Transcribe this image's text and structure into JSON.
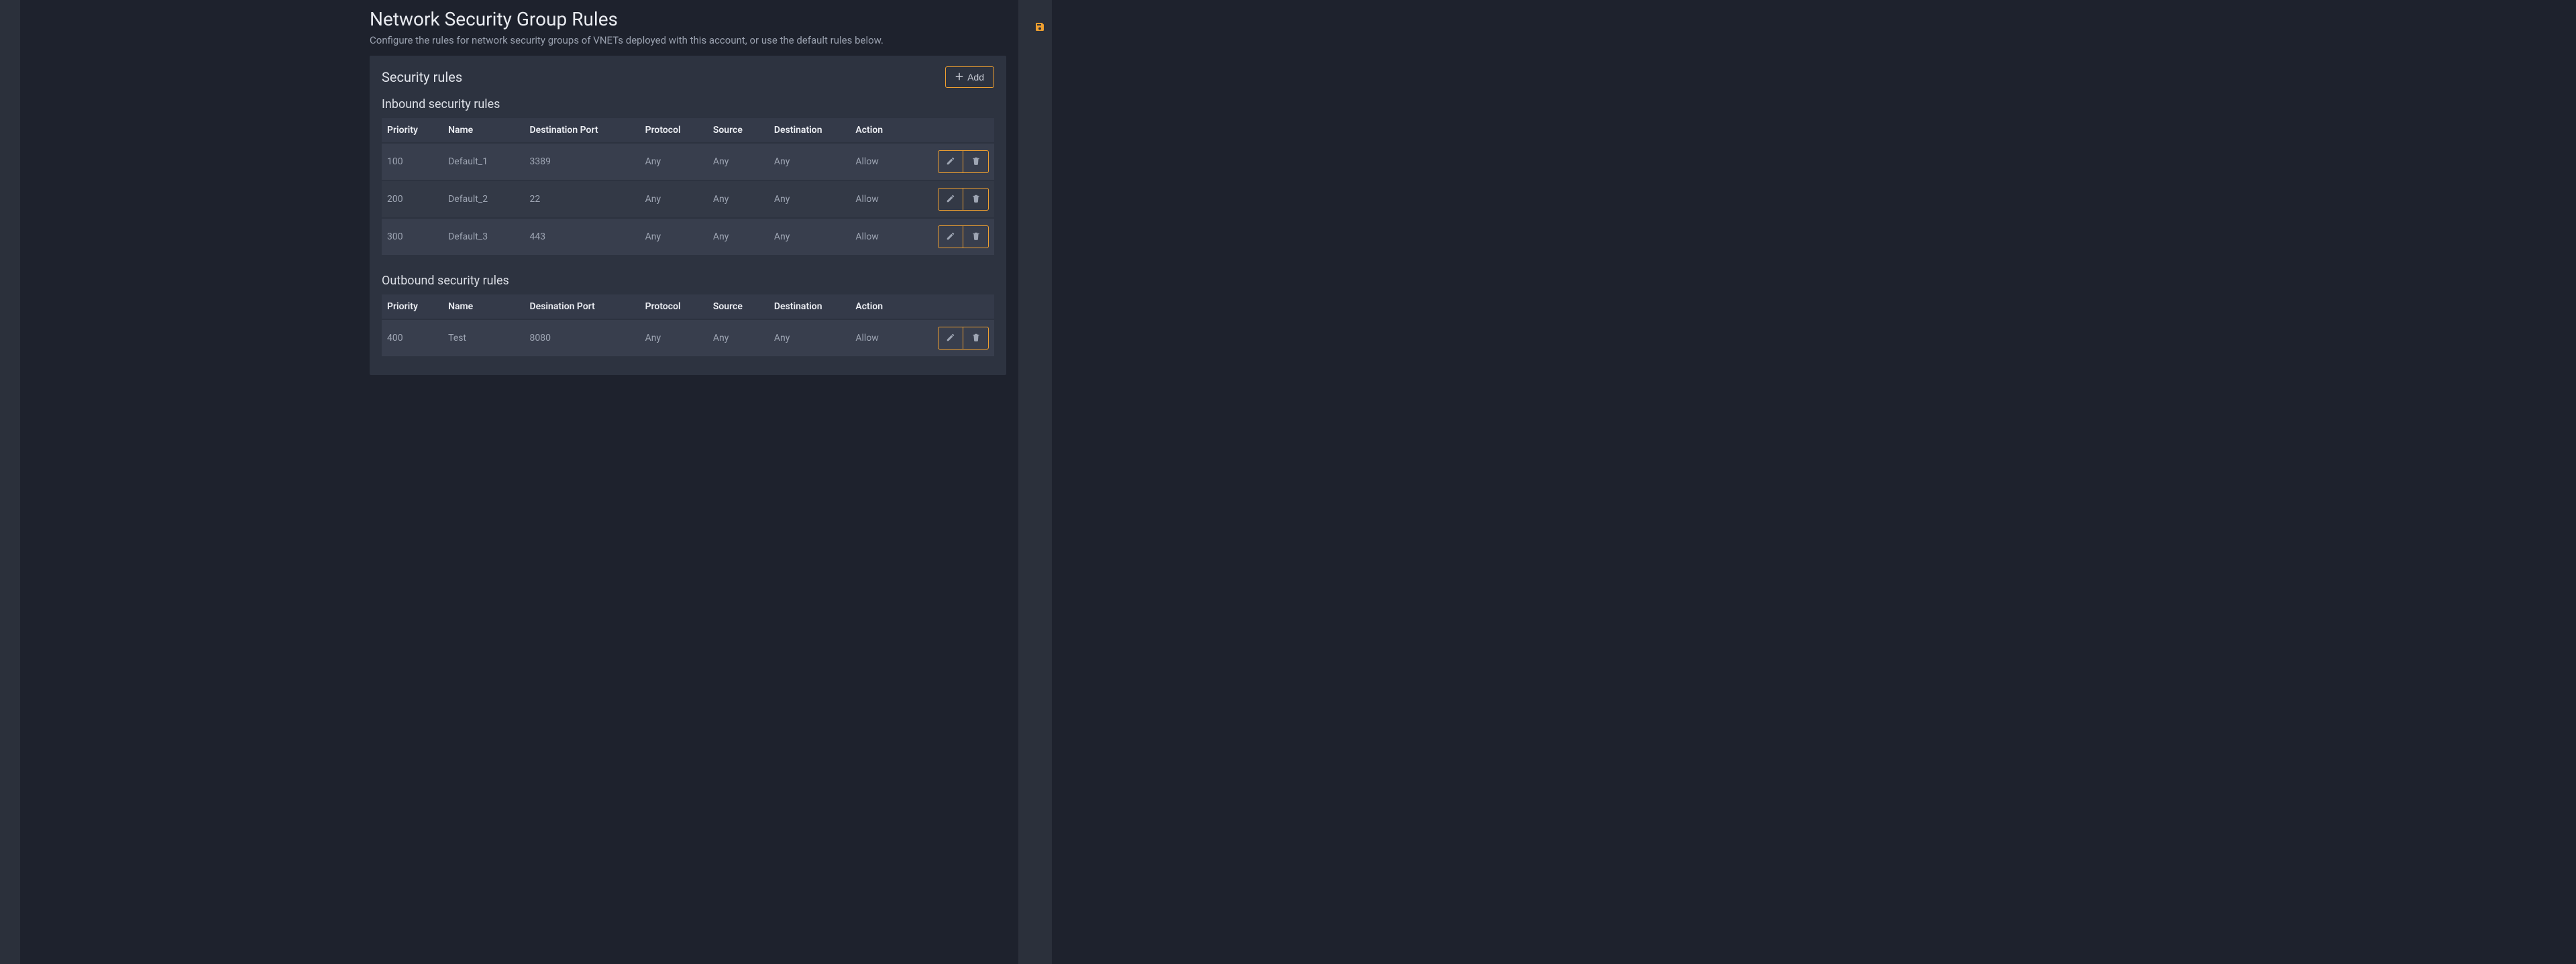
{
  "page": {
    "title": "Network Security Group Rules",
    "subtitle": "Configure the rules for network security groups of VNETs deployed with this account, or use the default rules below."
  },
  "card": {
    "title": "Security rules",
    "add_label": "Add"
  },
  "inbound": {
    "title": "Inbound security rules",
    "headers": {
      "priority": "Priority",
      "name": "Name",
      "port": "Destination Port",
      "protocol": "Protocol",
      "source": "Source",
      "destination": "Destination",
      "action": "Action"
    },
    "rows": [
      {
        "priority": "100",
        "name": "Default_1",
        "port": "3389",
        "protocol": "Any",
        "source": "Any",
        "destination": "Any",
        "action": "Allow"
      },
      {
        "priority": "200",
        "name": "Default_2",
        "port": "22",
        "protocol": "Any",
        "source": "Any",
        "destination": "Any",
        "action": "Allow"
      },
      {
        "priority": "300",
        "name": "Default_3",
        "port": "443",
        "protocol": "Any",
        "source": "Any",
        "destination": "Any",
        "action": "Allow"
      }
    ]
  },
  "outbound": {
    "title": "Outbound security rules",
    "headers": {
      "priority": "Priority",
      "name": "Name",
      "port": "Desination Port",
      "protocol": "Protocol",
      "source": "Source",
      "destination": "Destination",
      "action": "Action"
    },
    "rows": [
      {
        "priority": "400",
        "name": "Test",
        "port": "8080",
        "protocol": "Any",
        "source": "Any",
        "destination": "Any",
        "action": "Allow"
      }
    ]
  }
}
